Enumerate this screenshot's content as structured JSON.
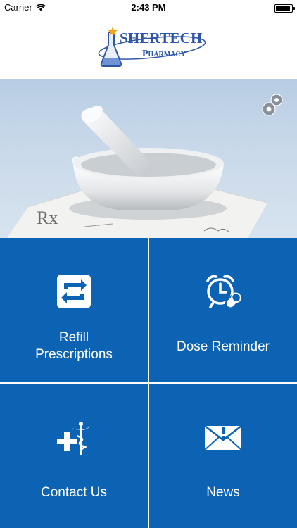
{
  "status_bar": {
    "carrier": "Carrier",
    "time": "2:43 PM"
  },
  "brand": {
    "name": "SHERTECH",
    "tagline": "Pharmacy"
  },
  "hero": {
    "rx_mark": "Rx"
  },
  "tiles": [
    {
      "label_line1": "Refill",
      "label_line2": "Prescriptions",
      "icon": "refill-arrows-icon"
    },
    {
      "label": "Dose Reminder",
      "icon": "alarm-pill-icon"
    },
    {
      "label": "Contact Us",
      "icon": "medical-caduceus-icon"
    },
    {
      "label": "News",
      "icon": "envelope-alert-icon"
    }
  ],
  "colors": {
    "tile_blue": "#0d63b3",
    "brand_blue": "#2f57a8"
  }
}
